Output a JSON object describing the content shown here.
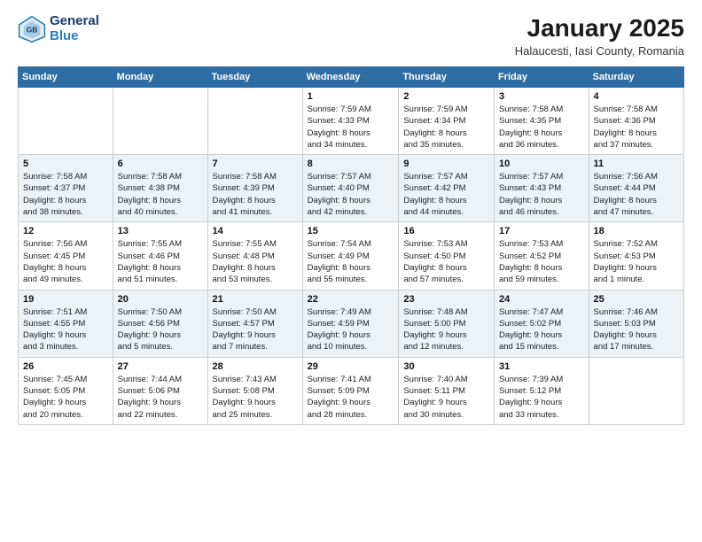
{
  "header": {
    "logo_line1": "General",
    "logo_line2": "Blue",
    "month": "January 2025",
    "location": "Halaucesti, Iasi County, Romania"
  },
  "weekdays": [
    "Sunday",
    "Monday",
    "Tuesday",
    "Wednesday",
    "Thursday",
    "Friday",
    "Saturday"
  ],
  "weeks": [
    [
      {
        "day": "",
        "info": ""
      },
      {
        "day": "",
        "info": ""
      },
      {
        "day": "",
        "info": ""
      },
      {
        "day": "1",
        "info": "Sunrise: 7:59 AM\nSunset: 4:33 PM\nDaylight: 8 hours\nand 34 minutes."
      },
      {
        "day": "2",
        "info": "Sunrise: 7:59 AM\nSunset: 4:34 PM\nDaylight: 8 hours\nand 35 minutes."
      },
      {
        "day": "3",
        "info": "Sunrise: 7:58 AM\nSunset: 4:35 PM\nDaylight: 8 hours\nand 36 minutes."
      },
      {
        "day": "4",
        "info": "Sunrise: 7:58 AM\nSunset: 4:36 PM\nDaylight: 8 hours\nand 37 minutes."
      }
    ],
    [
      {
        "day": "5",
        "info": "Sunrise: 7:58 AM\nSunset: 4:37 PM\nDaylight: 8 hours\nand 38 minutes."
      },
      {
        "day": "6",
        "info": "Sunrise: 7:58 AM\nSunset: 4:38 PM\nDaylight: 8 hours\nand 40 minutes."
      },
      {
        "day": "7",
        "info": "Sunrise: 7:58 AM\nSunset: 4:39 PM\nDaylight: 8 hours\nand 41 minutes."
      },
      {
        "day": "8",
        "info": "Sunrise: 7:57 AM\nSunset: 4:40 PM\nDaylight: 8 hours\nand 42 minutes."
      },
      {
        "day": "9",
        "info": "Sunrise: 7:57 AM\nSunset: 4:42 PM\nDaylight: 8 hours\nand 44 minutes."
      },
      {
        "day": "10",
        "info": "Sunrise: 7:57 AM\nSunset: 4:43 PM\nDaylight: 8 hours\nand 46 minutes."
      },
      {
        "day": "11",
        "info": "Sunrise: 7:56 AM\nSunset: 4:44 PM\nDaylight: 8 hours\nand 47 minutes."
      }
    ],
    [
      {
        "day": "12",
        "info": "Sunrise: 7:56 AM\nSunset: 4:45 PM\nDaylight: 8 hours\nand 49 minutes."
      },
      {
        "day": "13",
        "info": "Sunrise: 7:55 AM\nSunset: 4:46 PM\nDaylight: 8 hours\nand 51 minutes."
      },
      {
        "day": "14",
        "info": "Sunrise: 7:55 AM\nSunset: 4:48 PM\nDaylight: 8 hours\nand 53 minutes."
      },
      {
        "day": "15",
        "info": "Sunrise: 7:54 AM\nSunset: 4:49 PM\nDaylight: 8 hours\nand 55 minutes."
      },
      {
        "day": "16",
        "info": "Sunrise: 7:53 AM\nSunset: 4:50 PM\nDaylight: 8 hours\nand 57 minutes."
      },
      {
        "day": "17",
        "info": "Sunrise: 7:53 AM\nSunset: 4:52 PM\nDaylight: 8 hours\nand 59 minutes."
      },
      {
        "day": "18",
        "info": "Sunrise: 7:52 AM\nSunset: 4:53 PM\nDaylight: 9 hours\nand 1 minute."
      }
    ],
    [
      {
        "day": "19",
        "info": "Sunrise: 7:51 AM\nSunset: 4:55 PM\nDaylight: 9 hours\nand 3 minutes."
      },
      {
        "day": "20",
        "info": "Sunrise: 7:50 AM\nSunset: 4:56 PM\nDaylight: 9 hours\nand 5 minutes."
      },
      {
        "day": "21",
        "info": "Sunrise: 7:50 AM\nSunset: 4:57 PM\nDaylight: 9 hours\nand 7 minutes."
      },
      {
        "day": "22",
        "info": "Sunrise: 7:49 AM\nSunset: 4:59 PM\nDaylight: 9 hours\nand 10 minutes."
      },
      {
        "day": "23",
        "info": "Sunrise: 7:48 AM\nSunset: 5:00 PM\nDaylight: 9 hours\nand 12 minutes."
      },
      {
        "day": "24",
        "info": "Sunrise: 7:47 AM\nSunset: 5:02 PM\nDaylight: 9 hours\nand 15 minutes."
      },
      {
        "day": "25",
        "info": "Sunrise: 7:46 AM\nSunset: 5:03 PM\nDaylight: 9 hours\nand 17 minutes."
      }
    ],
    [
      {
        "day": "26",
        "info": "Sunrise: 7:45 AM\nSunset: 5:05 PM\nDaylight: 9 hours\nand 20 minutes."
      },
      {
        "day": "27",
        "info": "Sunrise: 7:44 AM\nSunset: 5:06 PM\nDaylight: 9 hours\nand 22 minutes."
      },
      {
        "day": "28",
        "info": "Sunrise: 7:43 AM\nSunset: 5:08 PM\nDaylight: 9 hours\nand 25 minutes."
      },
      {
        "day": "29",
        "info": "Sunrise: 7:41 AM\nSunset: 5:09 PM\nDaylight: 9 hours\nand 28 minutes."
      },
      {
        "day": "30",
        "info": "Sunrise: 7:40 AM\nSunset: 5:11 PM\nDaylight: 9 hours\nand 30 minutes."
      },
      {
        "day": "31",
        "info": "Sunrise: 7:39 AM\nSunset: 5:12 PM\nDaylight: 9 hours\nand 33 minutes."
      },
      {
        "day": "",
        "info": ""
      }
    ]
  ]
}
